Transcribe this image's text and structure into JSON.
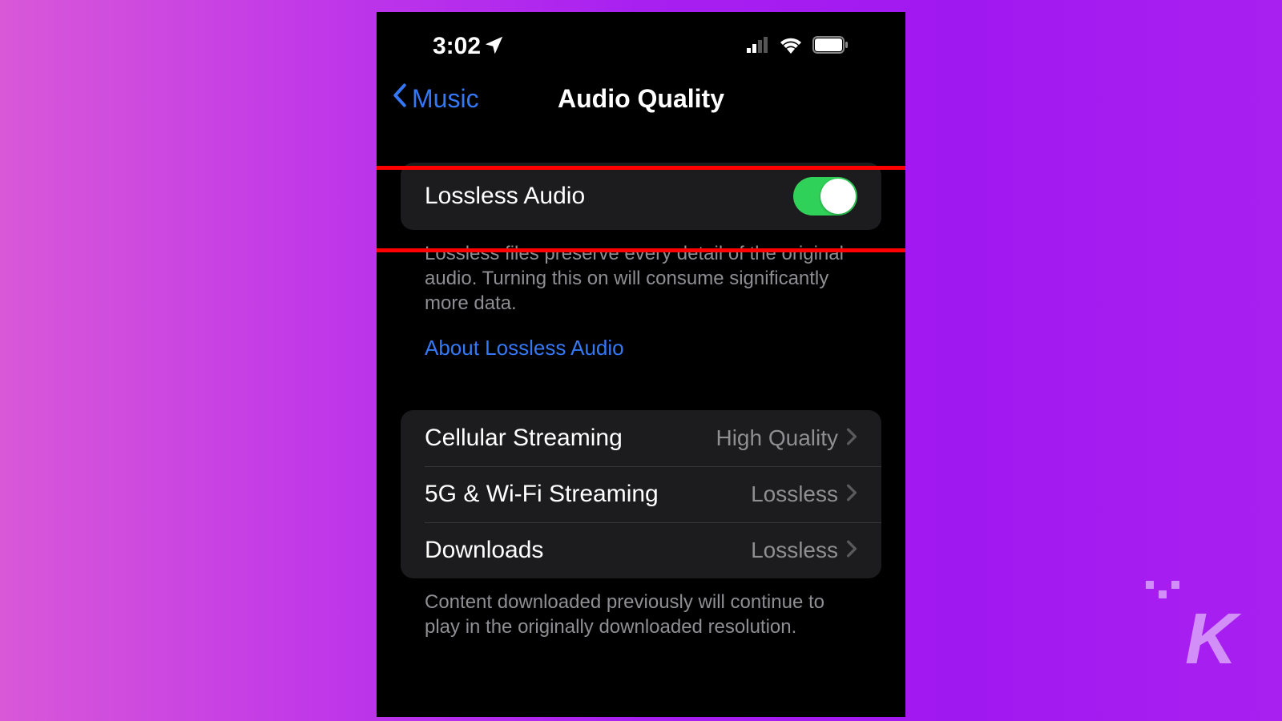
{
  "status": {
    "time": "3:02"
  },
  "nav": {
    "back_label": "Music",
    "title": "Audio Quality"
  },
  "lossless": {
    "label": "Lossless Audio",
    "footer": "Lossless files preserve every detail of the original audio. Turning this on will consume significantly more data.",
    "link": "About Lossless Audio"
  },
  "quality": {
    "items": [
      {
        "label": "Cellular Streaming",
        "value": "High Quality"
      },
      {
        "label": "5G & Wi-Fi Streaming",
        "value": "Lossless"
      },
      {
        "label": "Downloads",
        "value": "Lossless"
      }
    ],
    "footer": "Content downloaded previously will continue to play in the originally downloaded resolution."
  },
  "watermark": "K"
}
